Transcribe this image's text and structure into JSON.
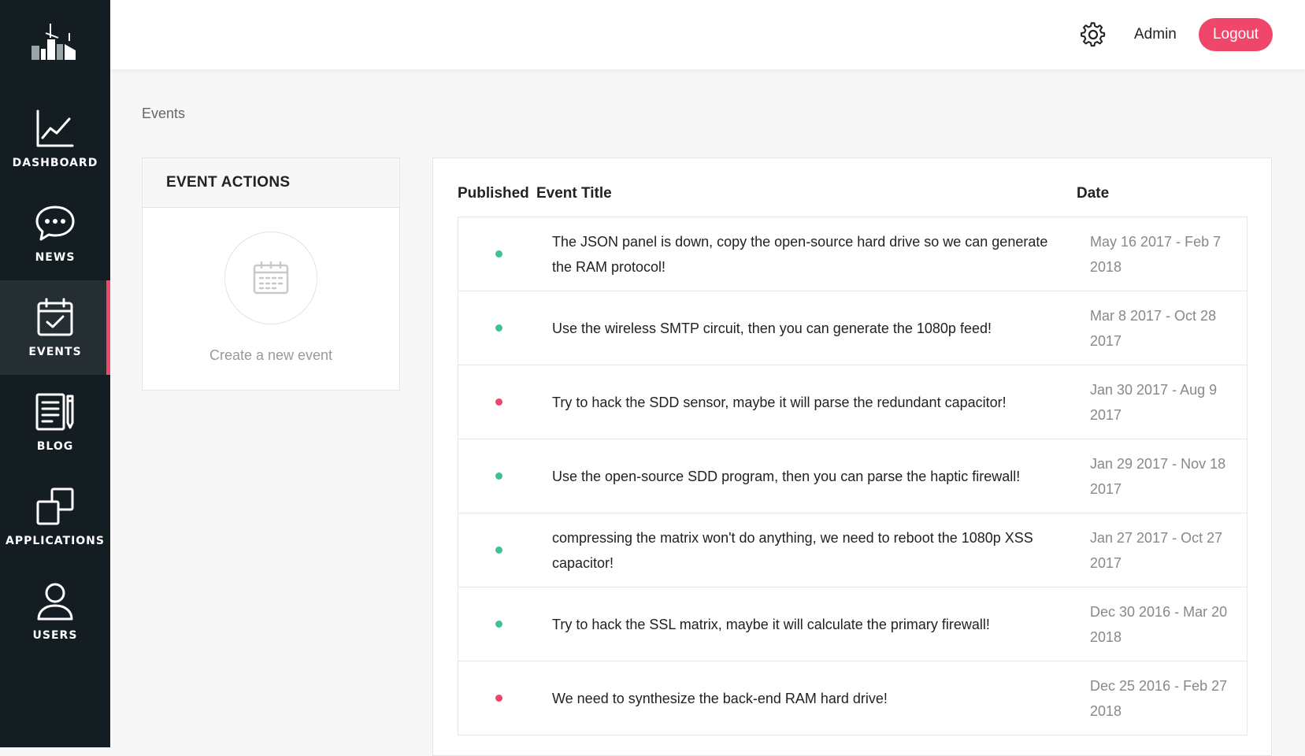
{
  "sidebar": {
    "items": [
      {
        "label": "DASHBOARD",
        "icon": "chart-line-icon"
      },
      {
        "label": "NEWS",
        "icon": "chat-bubble-icon"
      },
      {
        "label": "EVENTS",
        "icon": "calendar-check-icon",
        "active": true
      },
      {
        "label": "BLOG",
        "icon": "document-pen-icon"
      },
      {
        "label": "APPLICATIONS",
        "icon": "windows-icon"
      },
      {
        "label": "USERS",
        "icon": "user-icon"
      }
    ]
  },
  "header": {
    "settings_icon": "gear-icon",
    "user_label": "Admin",
    "logout_label": "Logout"
  },
  "breadcrumb": "Events",
  "actions": {
    "title": "EVENT ACTIONS",
    "create_label": "Create a new event",
    "create_icon": "calendar-icon"
  },
  "table": {
    "headers": {
      "published": "Published",
      "title": "Event Title",
      "date": "Date"
    },
    "rows": [
      {
        "published": true,
        "title": "The JSON panel is down, copy the open-source hard drive so we can generate the RAM protocol!",
        "date": "May 16 2017 - Feb 7 2018"
      },
      {
        "published": true,
        "title": "Use the wireless SMTP circuit, then you can generate the 1080p feed!",
        "date": "Mar 8 2017 - Oct 28 2017"
      },
      {
        "published": false,
        "title": "Try to hack the SDD sensor, maybe it will parse the redundant capacitor!",
        "date": "Jan 30 2017 - Aug 9 2017"
      },
      {
        "published": true,
        "title": "Use the open-source SDD program, then you can parse the haptic firewall!",
        "date": "Jan 29 2017 - Nov 18 2017"
      },
      {
        "published": true,
        "title": "compressing the matrix won't do anything, we need to reboot the 1080p XSS capacitor!",
        "date": "Jan 27 2017 - Oct 27 2017"
      },
      {
        "published": true,
        "title": "Try to hack the SSL matrix, maybe it will calculate the primary firewall!",
        "date": "Dec 30 2016 - Mar 20 2018"
      },
      {
        "published": false,
        "title": "We need to synthesize the back-end RAM hard drive!",
        "date": "Dec 25 2016 - Feb 27 2018"
      }
    ]
  },
  "colors": {
    "accent": "#f0466a",
    "published": "#3ec38e",
    "unpublished": "#f0466a",
    "sidebar": "#141e22"
  }
}
